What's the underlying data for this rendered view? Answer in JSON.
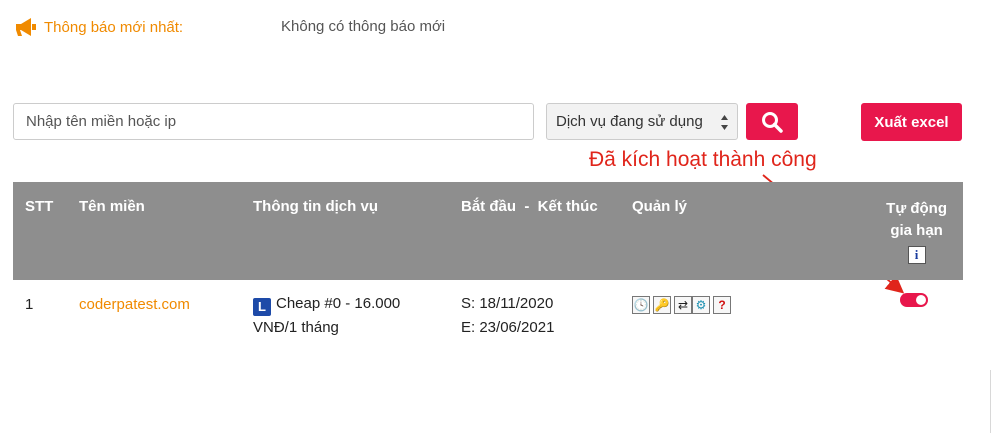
{
  "notice": {
    "label": "Thông báo mới nhất:",
    "message": "Không có thông báo mới",
    "icon": "megaphone-icon"
  },
  "filters": {
    "search_placeholder": "Nhập tên miền hoặc ip",
    "search_value": "",
    "service_selected": "Dịch vụ đang sử dụng",
    "search_icon": "search-icon",
    "export_label": "Xuất excel"
  },
  "annotation": {
    "text": "Đã kích hoạt thành công",
    "color": "#e0251b"
  },
  "table": {
    "headers": {
      "stt": "STT",
      "domain": "Tên miền",
      "service_info": "Thông tin dịch vụ",
      "start_end": "Bắt đầu  -  Kết thúc",
      "manage": "Quản lý",
      "auto_renew_line1": "Tự động",
      "auto_renew_line2": "gia hạn",
      "info_glyph": "i"
    },
    "rows": [
      {
        "stt": "1",
        "domain": "coderpatest.com",
        "plan_badge": "L",
        "plan_line1": "Cheap #0 - 16.000",
        "plan_line2": "VNĐ/1 tháng",
        "start": "S: 18/11/2020",
        "end": "E: 23/06/2021",
        "manage_icons": [
          "clock-star-icon",
          "key-icon",
          "transfer-icon",
          "gear-icon",
          "help-icon"
        ],
        "manage_glyphs": [
          "🕓",
          "🔑",
          "⇄",
          "⚙",
          "?"
        ],
        "auto_renew": true
      }
    ]
  },
  "colors": {
    "accent": "#e8174c",
    "orange": "#f08a00",
    "header_bg": "#8e8e8e"
  }
}
